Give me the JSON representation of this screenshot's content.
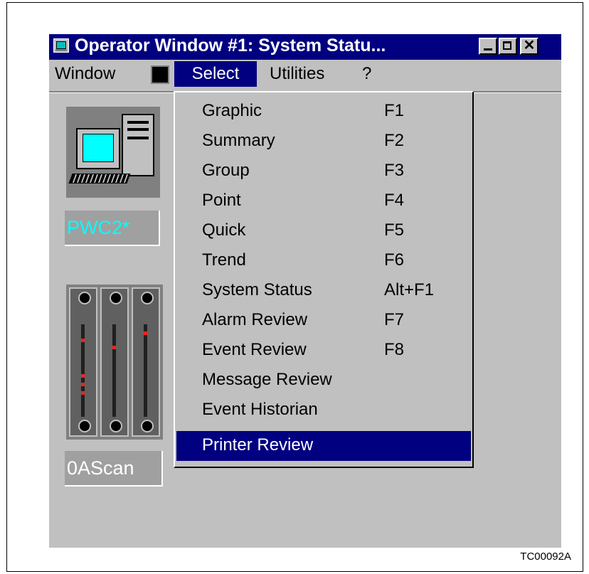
{
  "window": {
    "title": "Operator Window #1: System Statu...",
    "controls": {
      "minimize": "minimize",
      "maximize": "maximize",
      "close": "✕"
    }
  },
  "menubar": {
    "items": [
      {
        "label": "Window"
      },
      {
        "label": "Select",
        "active": true
      },
      {
        "label": "Utilities"
      },
      {
        "label": "?"
      }
    ]
  },
  "dropdown": {
    "items": [
      {
        "label": "Graphic",
        "shortcut": "F1"
      },
      {
        "label": "Summary",
        "shortcut": "F2"
      },
      {
        "label": "Group",
        "shortcut": "F3"
      },
      {
        "label": "Point",
        "shortcut": "F4"
      },
      {
        "label": "Quick",
        "shortcut": "F5"
      },
      {
        "label": "Trend",
        "shortcut": "F6"
      },
      {
        "label": "System Status",
        "shortcut": "Alt+F1"
      },
      {
        "label": "Alarm Review",
        "shortcut": "F7"
      },
      {
        "label": "Event Review",
        "shortcut": "F8"
      },
      {
        "label": "Message Review",
        "shortcut": ""
      },
      {
        "label": "Event Historian",
        "shortcut": ""
      },
      {
        "label": "Printer Review",
        "shortcut": "",
        "highlighted": true
      }
    ]
  },
  "nodes": [
    {
      "label": "PWC2*",
      "icon": "computer-icon",
      "color": "#00ffff"
    },
    {
      "label": "0AScan",
      "icon": "controller-rack-icon",
      "color": "#ffffff"
    }
  ],
  "figure_id": "TC00092A",
  "colors": {
    "titlebar": "#000080",
    "menu_highlight": "#000080",
    "window_face": "#c0c0c0"
  }
}
